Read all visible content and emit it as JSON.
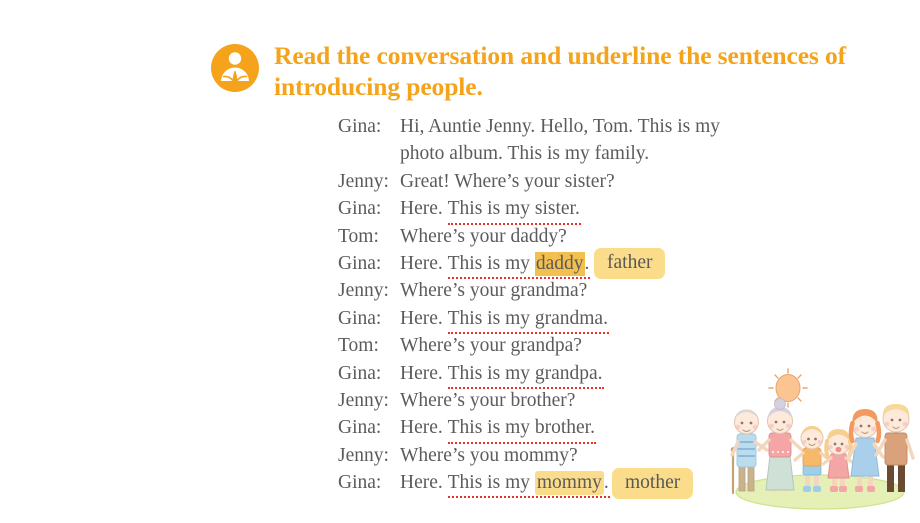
{
  "header": {
    "icon": "reading-person-icon",
    "title": "Read the conversation and underline the sentences of introducing people.",
    "accent_color": "#f5a31a"
  },
  "colors": {
    "title": "#f5a31a",
    "body_text": "#5b5b5b",
    "underline": "#ee3124",
    "highlight_deep": "#f3c04f",
    "highlight_soft": "#fbdc8a",
    "background": "#ffffff"
  },
  "dialogue": {
    "lines": [
      {
        "speaker": "Gina:",
        "pre": "Hi, Auntie Jenny. Hello, Tom. This is my",
        "underlined": "",
        "highlight": "",
        "post": ""
      },
      {
        "speaker": "",
        "pre": "photo album. This is my family.",
        "underlined": "",
        "highlight": "",
        "post": ""
      },
      {
        "speaker": "Jenny:",
        "pre": "Great! Where’s your sister?",
        "underlined": "",
        "highlight": "",
        "post": ""
      },
      {
        "speaker": "Gina:",
        "pre": "Here. ",
        "underlined": "This is my sister.",
        "highlight": "",
        "post": ""
      },
      {
        "speaker": "Tom:",
        "pre": "Where’s your daddy?",
        "underlined": "",
        "highlight": "",
        "post": ""
      },
      {
        "speaker": "Gina:",
        "pre": "Here. ",
        "underlined": "This is my ",
        "highlight": "daddy",
        "post": "."
      },
      {
        "speaker": "Jenny:",
        "pre": "Where’s your grandma?",
        "underlined": "",
        "highlight": "",
        "post": ""
      },
      {
        "speaker": "Gina:",
        "pre": "Here. ",
        "underlined": "This is my grandma.",
        "highlight": "",
        "post": ""
      },
      {
        "speaker": "Tom:",
        "pre": "Where’s your grandpa?",
        "underlined": "",
        "highlight": "",
        "post": ""
      },
      {
        "speaker": "Gina:",
        "pre": "Here. ",
        "underlined": "This is my grandpa.",
        "highlight": "",
        "post": ""
      },
      {
        "speaker": "Jenny:",
        "pre": "Where’s your brother?",
        "underlined": "",
        "highlight": "",
        "post": ""
      },
      {
        "speaker": "Gina:",
        "pre": "Here. ",
        "underlined": "This is my brother.",
        "highlight": "",
        "post": ""
      },
      {
        "speaker": "Jenny:",
        "pre": "Where’s you mommy?",
        "underlined": "",
        "highlight": "",
        "post": ""
      },
      {
        "speaker": "Gina:",
        "pre": "Here. ",
        "underlined": "This is my ",
        "highlight": "mommy",
        "post": "."
      }
    ]
  },
  "callouts": {
    "father": "father",
    "mother": "mother"
  },
  "illustration": {
    "name": "family-illustration",
    "sun": "sun-icon",
    "figures": [
      "grandfather",
      "grandmother",
      "boy",
      "girl",
      "mother",
      "father"
    ]
  }
}
